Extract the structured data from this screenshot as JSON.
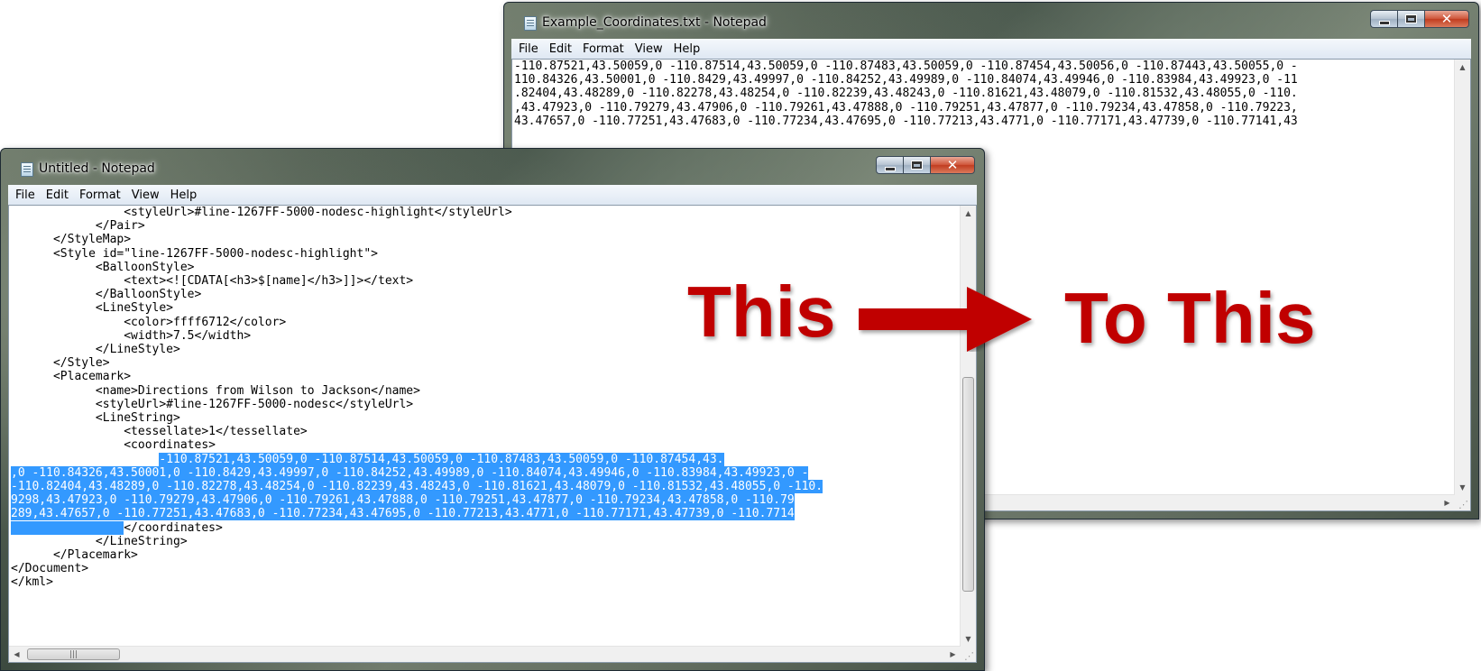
{
  "colors": {
    "caption": "#c00000",
    "selection": "#3399ff"
  },
  "window_back": {
    "title": "Example_Coordinates.txt - Notepad",
    "menu": [
      "File",
      "Edit",
      "Format",
      "View",
      "Help"
    ],
    "lines": [
      "-110.87521,43.50059,0 -110.87514,43.50059,0 -110.87483,43.50059,0 -110.87454,43.50056,0 -110.87443,43.50055,0 -",
      "110.84326,43.50001,0 -110.8429,43.49997,0 -110.84252,43.49989,0 -110.84074,43.49946,0 -110.83984,43.49923,0 -11",
      ".82404,43.48289,0 -110.82278,43.48254,0 -110.82239,43.48243,0 -110.81621,43.48079,0 -110.81532,43.48055,0 -110.",
      ",43.47923,0 -110.79279,43.47906,0 -110.79261,43.47888,0 -110.79251,43.47877,0 -110.79234,43.47858,0 -110.79223,",
      "43.47657,0 -110.77251,43.47683,0 -110.77234,43.47695,0 -110.77213,43.4771,0 -110.77171,43.47739,0 -110.77141,43"
    ]
  },
  "window_front": {
    "title": "Untitled - Notepad",
    "menu": [
      "File",
      "Edit",
      "Format",
      "View",
      "Help"
    ],
    "lines": [
      "                <styleUrl>#line-1267FF-5000-nodesc-highlight</styleUrl>",
      "            </Pair>",
      "      </StyleMap>",
      "      <Style id=\"line-1267FF-5000-nodesc-highlight\">",
      "            <BalloonStyle>",
      "                <text><![CDATA[<h3>$[name]</h3>]]></text>",
      "            </BalloonStyle>",
      "            <LineStyle>",
      "                <color>ffff6712</color>",
      "                <width>7.5</width>",
      "            </LineStyle>",
      "      </Style>",
      "      <Placemark>",
      "            <name>Directions from Wilson to Jackson</name>",
      "            <styleUrl>#line-1267FF-5000-nodesc</styleUrl>",
      "            <LineString>",
      "                <tessellate>1</tessellate>",
      "                <coordinates>"
    ],
    "sel_prefix": "                     ",
    "sel_lines": [
      "-110.87521,43.50059,0 -110.87514,43.50059,0 -110.87483,43.50059,0 -110.87454,43.",
      ",0 -110.84326,43.50001,0 -110.8429,43.49997,0 -110.84252,43.49989,0 -110.84074,43.49946,0 -110.83984,43.49923,0 -",
      "-110.82404,43.48289,0 -110.82278,43.48254,0 -110.82239,43.48243,0 -110.81621,43.48079,0 -110.81532,43.48055,0 -110.",
      "9298,43.47923,0 -110.79279,43.47906,0 -110.79261,43.47888,0 -110.79251,43.47877,0 -110.79234,43.47858,0 -110.79",
      "289,43.47657,0 -110.77251,43.47683,0 -110.77234,43.47695,0 -110.77213,43.4771,0 -110.77171,43.47739,0 -110.7714"
    ],
    "sel_tail_ws": "                ",
    "close_coords": "</coordinates>",
    "after_lines": [
      "            </LineString>",
      "      </Placemark>",
      "</Document>",
      "</kml>"
    ]
  },
  "captions": {
    "this": "This",
    "to_this": "To This"
  }
}
